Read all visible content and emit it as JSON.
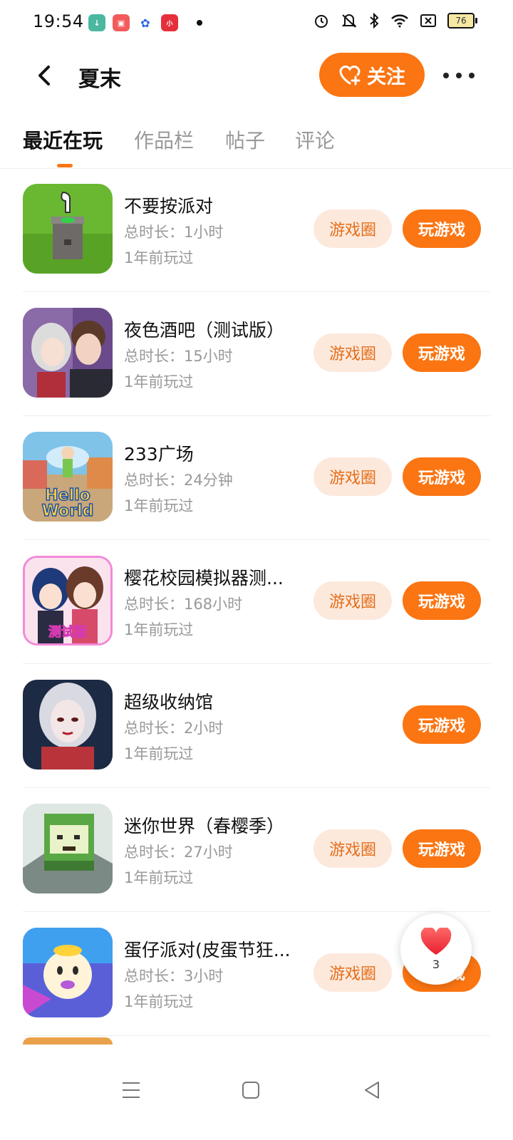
{
  "status_bar": {
    "time": "19:54",
    "battery": "76",
    "app_icons": [
      {
        "name": "download-app-icon",
        "color": "#4ab8a0",
        "glyph": "↓"
      },
      {
        "name": "video-app-icon",
        "color": "#f25b5b",
        "glyph": "●"
      },
      {
        "name": "baidu-app-icon",
        "color": "#ffffff",
        "glyph": "🐾"
      },
      {
        "name": "xiaohongshu-app-icon",
        "color": "#e5303c",
        "glyph": "小"
      }
    ]
  },
  "header": {
    "title": "夏末",
    "follow_label": "关注"
  },
  "tabs": [
    {
      "label": "最近在玩",
      "active": true
    },
    {
      "label": "作品栏",
      "active": false
    },
    {
      "label": "帖子",
      "active": false
    },
    {
      "label": "评论",
      "active": false
    }
  ],
  "buttons": {
    "circle_label": "游戏圈",
    "play_label": "玩游戏"
  },
  "games": [
    {
      "title": "不要按派对",
      "duration": "总时长：1小时",
      "played": "1年前玩过",
      "has_circle": true,
      "thumb": "green"
    },
    {
      "title": "夜色酒吧（测试版）",
      "duration": "总时长：15小时",
      "played": "1年前玩过",
      "has_circle": true,
      "thumb": "anime"
    },
    {
      "title": "233广场",
      "duration": "总时长：24分钟",
      "played": "1年前玩过",
      "has_circle": true,
      "thumb": "hello"
    },
    {
      "title": "樱花校园模拟器测...",
      "duration": "总时长：168小时",
      "played": "1年前玩过",
      "has_circle": true,
      "thumb": "sakura"
    },
    {
      "title": "超级收纳馆",
      "duration": "总时长：2小时",
      "played": "1年前玩过",
      "has_circle": false,
      "thumb": "ghost"
    },
    {
      "title": "迷你世界（春樱季）",
      "duration": "总时长：27小时",
      "played": "1年前玩过",
      "has_circle": true,
      "thumb": "mini"
    },
    {
      "title": "蛋仔派对(皮蛋节狂...",
      "duration": "总时长：3小时",
      "played": "1年前玩过",
      "has_circle": true,
      "thumb": "egg"
    }
  ],
  "float_like": {
    "count": "3"
  },
  "colors": {
    "accent": "#fb7512",
    "circle_bg": "#fde9dc",
    "circle_text": "#e46e1b"
  }
}
